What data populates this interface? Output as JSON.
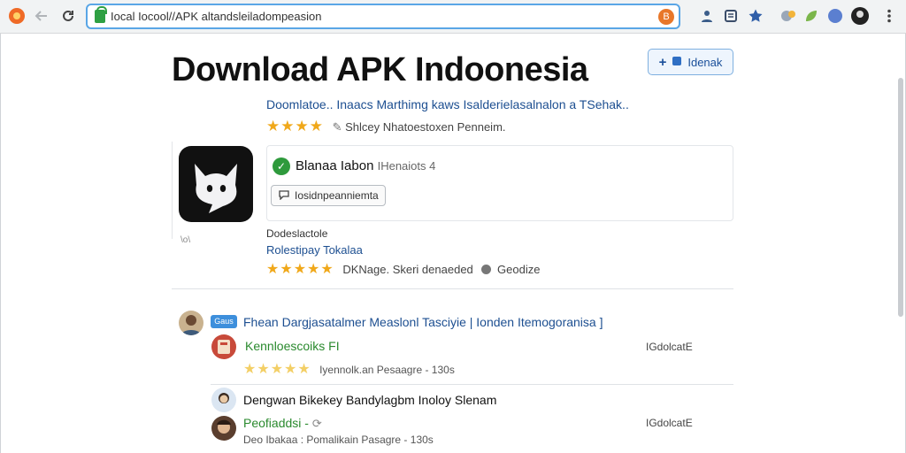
{
  "browser": {
    "url": "Iocal Iocool//APK altandsleiladompeasion",
    "site_badge": "B"
  },
  "page": {
    "title": "Download APK Indoonesia",
    "follow_button": "Idenak",
    "subtitle": "Doomlatoe.. Inaacs Marthimg kaws Isalderielasalnalon a TSehak..",
    "rating_stars": "★★★★",
    "rating_text": "Shlcey Nhatoestoxen Penneim.",
    "app_caption": "\\o\\",
    "card": {
      "name": "Blanaa Iabon",
      "version": "IHenaiots 4",
      "button_label": "Iosidnpeanniemta"
    },
    "developer_label": "Dodeslactole",
    "developer_name": "Rolestipay Tokalaa",
    "meta_stars": "★★★★★",
    "meta_text": "DKNage. Skeri denaeded",
    "meta_extra": "Geodize"
  },
  "thread": {
    "tag": "Gaus",
    "title": "Fhean Dargjasatalmer Measlonl Tasciyie | Ionden Itemogoranisa ]"
  },
  "rows": [
    {
      "name": "Kennloescoiks FI",
      "stars": "★★★★★",
      "subtitle": "Iyennolk.an Pesaagre - 130s",
      "size": "IGdolcatE"
    },
    {
      "title": "Dengwan Bikekey Bandylagbm Inoloy Slenam"
    },
    {
      "name": "Peofiaddsi -",
      "subtitle": "Deo Ibakaa : Pomalikain Pasagre - 130s",
      "size": "IGdolcatE"
    }
  ],
  "colors": {
    "accent_blue": "#1d4f91",
    "star_gold": "#f0a81a",
    "green": "#2a8a2e",
    "omnibox_border": "#5aa6e6"
  }
}
